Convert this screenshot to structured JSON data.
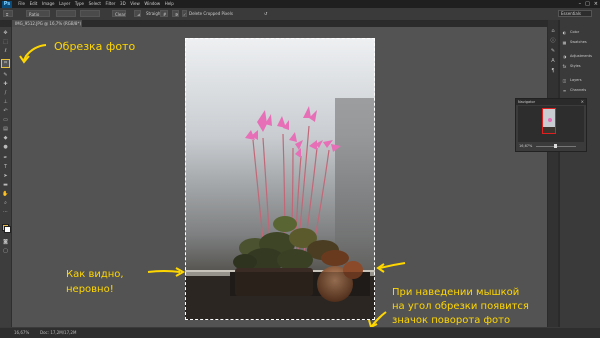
{
  "app": {
    "logo": "Ps",
    "menus": [
      "File",
      "Edit",
      "Image",
      "Layer",
      "Type",
      "Select",
      "Filter",
      "3D",
      "View",
      "Window",
      "Help"
    ],
    "window_controls": [
      "–",
      "□",
      "×"
    ]
  },
  "options": {
    "ratio_value": "Ratio",
    "straighten_label": "Straighten",
    "delete_cropped_label": "Delete Cropped Pixels",
    "clear_label": "Clear",
    "workspace": "Essentials"
  },
  "document": {
    "tab_title": "IMG_9512.JPG @ 16,7% (RGB/8*)"
  },
  "status": {
    "zoom": "16,67%",
    "doc_info": "Doc: 17,2M/17,2M"
  },
  "panels": {
    "items": [
      {
        "icon": "color-icon",
        "label": "Color"
      },
      {
        "icon": "swatches-icon",
        "label": "Swatches"
      },
      {
        "icon": "adjustments-icon",
        "label": "Adjustments"
      },
      {
        "icon": "styles-icon",
        "label": "Styles"
      },
      {
        "icon": "layers-icon",
        "label": "Layers"
      },
      {
        "icon": "channels-icon",
        "label": "Channels"
      },
      {
        "icon": "paths-icon",
        "label": "Paths"
      }
    ]
  },
  "navigator": {
    "title": "Navigator",
    "zoom": "16,67%"
  },
  "annotations": {
    "crop_title": "Обрезка фото",
    "uneven_line1": "Как видно,",
    "uneven_line2": "неровно!",
    "hover_line1": "При наведении мышкой",
    "hover_line2": "на угол обрезки появится",
    "hover_line3": "значок поворота фото"
  },
  "colors": {
    "annotation": "#ffd700",
    "active_tool_outline": "#e8c23a",
    "navigator_view_box": "#e02020"
  }
}
